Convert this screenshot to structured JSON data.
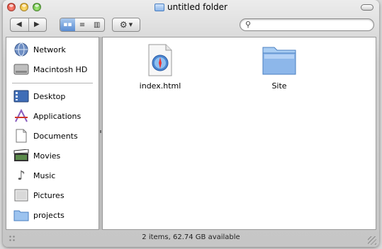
{
  "window": {
    "title": "untitled folder",
    "controls": [
      "close",
      "minimize",
      "zoom"
    ]
  },
  "toolbar": {
    "back_icon": "back-arrow-icon",
    "forward_icon": "forward-arrow-icon",
    "view_modes": [
      "icon-view",
      "list-view",
      "column-view"
    ],
    "selected_view": "icon-view",
    "action_icon": "gear-icon",
    "search": {
      "value": "",
      "placeholder": ""
    }
  },
  "sidebar": {
    "devices": [
      {
        "label": "Network",
        "icon": "network-globe-icon"
      },
      {
        "label": "Macintosh HD",
        "icon": "hard-disk-icon"
      }
    ],
    "places": [
      {
        "label": "Desktop",
        "icon": "desktop-icon"
      },
      {
        "label": "Applications",
        "icon": "applications-icon"
      },
      {
        "label": "Documents",
        "icon": "documents-icon"
      },
      {
        "label": "Movies",
        "icon": "movies-clapper-icon"
      },
      {
        "label": "Music",
        "icon": "music-note-icon"
      },
      {
        "label": "Pictures",
        "icon": "pictures-icon"
      },
      {
        "label": "projects",
        "icon": "folder-icon"
      }
    ]
  },
  "content": {
    "files": [
      {
        "name": "index.html",
        "icon": "safari-document-icon"
      },
      {
        "name": "Site",
        "icon": "folder-icon"
      }
    ]
  },
  "status": {
    "text": "2 items, 62.74 GB available"
  },
  "colors": {
    "accent": "#5b8dd3",
    "folder": "#8db7ea"
  }
}
